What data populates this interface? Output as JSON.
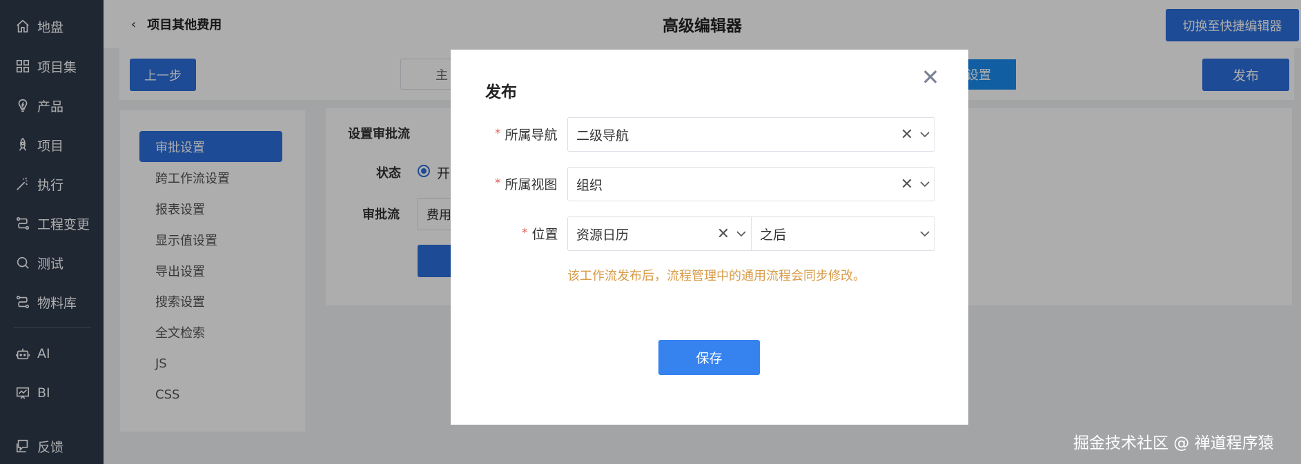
{
  "sidebar": {
    "items": [
      {
        "label": "地盘",
        "icon": "home-icon"
      },
      {
        "label": "项目集",
        "icon": "grid-icon"
      },
      {
        "label": "产品",
        "icon": "bulb-icon"
      },
      {
        "label": "项目",
        "icon": "rocket-icon"
      },
      {
        "label": "执行",
        "icon": "wand-icon"
      },
      {
        "label": "工程变更",
        "icon": "flow-icon"
      },
      {
        "label": "测试",
        "icon": "search-icon"
      },
      {
        "label": "物料库",
        "icon": "flow-icon"
      },
      {
        "label": "AI",
        "icon": "robot-icon"
      },
      {
        "label": "BI",
        "icon": "chart-icon"
      },
      {
        "label": "反馈",
        "icon": "feedback-icon"
      }
    ]
  },
  "header": {
    "back_label": "项目其他费用",
    "title": "高级编辑器",
    "switch_label": "切换至快捷编辑器"
  },
  "stepbar": {
    "prev_label": "上一步",
    "tab_partial": "主",
    "active_tab_partial": "设置",
    "publish_label": "发布"
  },
  "settings_menu": {
    "items": [
      "审批设置",
      "跨工作流设置",
      "报表设置",
      "显示值设置",
      "导出设置",
      "搜索设置",
      "全文检索",
      "JS",
      "CSS"
    ]
  },
  "content": {
    "title": "设置审批流",
    "status_label": "状态",
    "status_option": "开",
    "flow_label": "审批流",
    "flow_value": "费用"
  },
  "modal": {
    "title": "发布",
    "fields": {
      "nav": {
        "label": "所属导航",
        "value": "二级导航"
      },
      "view": {
        "label": "所属视图",
        "value": "组织"
      },
      "position": {
        "label": "位置",
        "value": "资源日历",
        "order": "之后"
      }
    },
    "required_mark": "*",
    "note": "该工作流发布后，流程管理中的通用流程会同步修改。",
    "save_label": "保存",
    "close_glyph": "✕"
  },
  "watermark": "掘金技术社区 @ 禅道程序猿"
}
